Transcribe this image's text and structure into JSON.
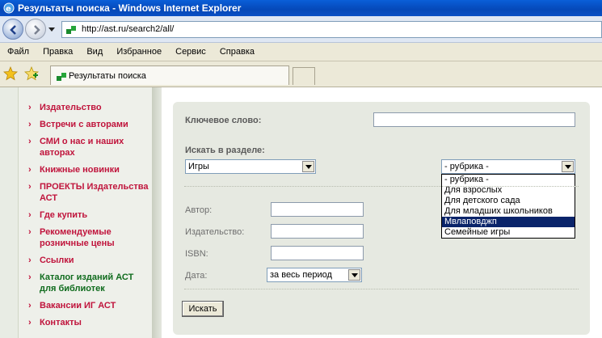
{
  "window": {
    "title": "Результаты поиска - Windows Internet Explorer"
  },
  "address": {
    "url": "http://ast.ru/search2/all/"
  },
  "menu": [
    "Файл",
    "Правка",
    "Вид",
    "Избранное",
    "Сервис",
    "Справка"
  ],
  "tab": {
    "label": "Результаты поиска"
  },
  "sidebar": {
    "items": [
      {
        "label": "Издательство",
        "color": "#c0143c"
      },
      {
        "label": "Встречи с авторами",
        "color": "#c0143c"
      },
      {
        "label": "СМИ о нас и наших авторах",
        "color": "#c0143c"
      },
      {
        "label": "Книжные новинки",
        "color": "#c0143c"
      },
      {
        "label": "ПРОЕКТЫ Издательства АСТ",
        "color": "#c0143c"
      },
      {
        "label": "Где купить",
        "color": "#c0143c"
      },
      {
        "label": "Рекомендуемые розничные цены",
        "color": "#c0143c"
      },
      {
        "label": "Ссылки",
        "color": "#c0143c"
      },
      {
        "label": "Каталог изданий АСТ для библиотек",
        "color": "#0f6b1d"
      },
      {
        "label": "Вакансии ИГ АСТ",
        "color": "#c0143c"
      },
      {
        "label": "Контакты",
        "color": "#c0143c"
      }
    ]
  },
  "search": {
    "keyword_label": "Ключевое слово:",
    "keyword_value": "",
    "section_label": "Искать в разделе:",
    "section_value": "Игры",
    "rubric_value": "- рубрика -",
    "rubric_options": [
      {
        "label": "- рубрика -",
        "selected": false
      },
      {
        "label": "Для взрослых",
        "selected": false
      },
      {
        "label": "Для детского сада",
        "selected": false
      },
      {
        "label": "Для младших школьников",
        "selected": false
      },
      {
        "label": "Мвлаповджп",
        "selected": true
      },
      {
        "label": "Семейные игры",
        "selected": false
      }
    ],
    "author_label": "Автор:",
    "publisher_label": "Издательство:",
    "isbn_label": "ISBN:",
    "date_label": "Дата:",
    "date_value": "за весь период",
    "submit_label": "Искать"
  }
}
